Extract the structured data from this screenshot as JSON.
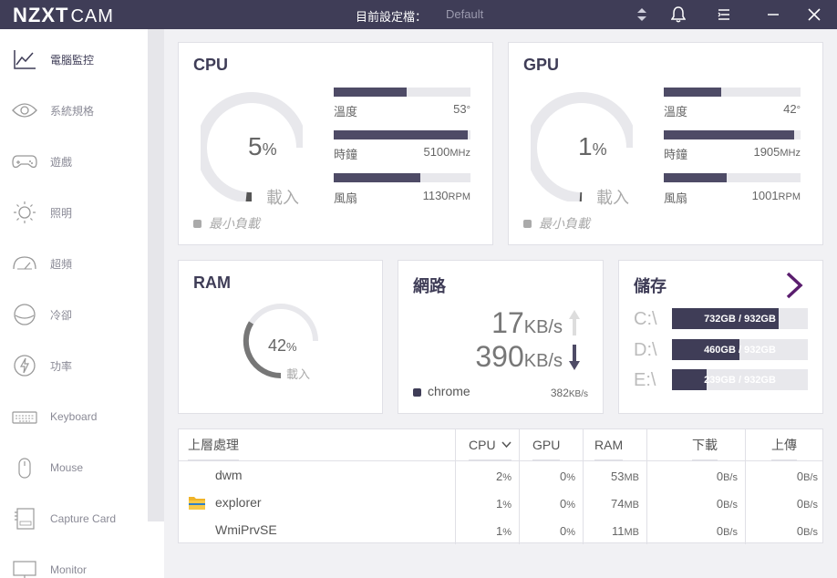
{
  "app": {
    "brand": "NZXT",
    "brand_suffix": "CAM",
    "profile_label": "目前設定檔：",
    "profile_value": "Default"
  },
  "sidebar": {
    "items": [
      {
        "label": "電腦監控",
        "icon": "chart-line-icon"
      },
      {
        "label": "系統規格",
        "icon": "eye-icon"
      },
      {
        "label": "遊戲",
        "icon": "gamepad-icon"
      },
      {
        "label": "照明",
        "icon": "sun-icon"
      },
      {
        "label": "超頻",
        "icon": "speedometer-icon"
      },
      {
        "label": "冷卻",
        "icon": "fan-icon"
      },
      {
        "label": "功率",
        "icon": "lightning-icon"
      },
      {
        "label": "Keyboard",
        "icon": "keyboard-icon"
      },
      {
        "label": "Mouse",
        "icon": "mouse-icon"
      },
      {
        "label": "Capture Card",
        "icon": "capture-card-icon"
      },
      {
        "label": "Monitor",
        "icon": "monitor-icon"
      }
    ]
  },
  "cpu": {
    "title": "CPU",
    "load_value": "5",
    "load_unit": "%",
    "load_fraction": 0.05,
    "load_label": "載入",
    "min_load": "最小負載",
    "stats": [
      {
        "label": "溫度",
        "value": "53",
        "unit": "°",
        "fill": 0.53
      },
      {
        "label": "時鐘",
        "value": "5100",
        "unit": "MHz",
        "fill": 0.98
      },
      {
        "label": "風扇",
        "value": "1130",
        "unit": "RPM",
        "fill": 0.63
      }
    ]
  },
  "gpu": {
    "title": "GPU",
    "load_value": "1",
    "load_unit": "%",
    "load_fraction": 0.01,
    "load_label": "載入",
    "min_load": "最小負載",
    "stats": [
      {
        "label": "溫度",
        "value": "42",
        "unit": "°",
        "fill": 0.42
      },
      {
        "label": "時鐘",
        "value": "1905",
        "unit": "MHz",
        "fill": 0.95
      },
      {
        "label": "風扇",
        "value": "1001",
        "unit": "RPM",
        "fill": 0.46
      }
    ]
  },
  "ram": {
    "title": "RAM",
    "load_value": "42",
    "load_unit": "%",
    "load_fraction": 0.42,
    "load_label": "載入"
  },
  "network": {
    "title": "網路",
    "upload_value": "17",
    "upload_unit": "KB/s",
    "download_value": "390",
    "download_unit": "KB/s",
    "top_process": "chrome",
    "top_process_value": "382",
    "top_process_unit": "KB/s"
  },
  "storage": {
    "title": "儲存",
    "drives": [
      {
        "label": "C:\\",
        "text": "732GB / 932GB",
        "fill": 0.785
      },
      {
        "label": "D:\\",
        "text": "460GB / 932GB",
        "fill": 0.494
      },
      {
        "label": "E:\\",
        "text": "239GB / 932GB",
        "fill": 0.256
      }
    ]
  },
  "processes": {
    "headers": {
      "name": "上層處理",
      "cpu": "CPU",
      "gpu": "GPU",
      "ram": "RAM",
      "download": "下載",
      "upload": "上傳"
    },
    "rows": [
      {
        "name": "dwm",
        "cpu": "2",
        "cpu_u": "%",
        "gpu": "0",
        "gpu_u": "%",
        "ram": "53",
        "ram_u": "MB",
        "down": "0",
        "down_u": "B/s",
        "up": "0",
        "up_u": "B/s"
      },
      {
        "name": "explorer",
        "cpu": "1",
        "cpu_u": "%",
        "gpu": "0",
        "gpu_u": "%",
        "ram": "74",
        "ram_u": "MB",
        "down": "0",
        "down_u": "B/s",
        "up": "0",
        "up_u": "B/s"
      },
      {
        "name": "WmiPrvSE",
        "cpu": "1",
        "cpu_u": "%",
        "gpu": "0",
        "gpu_u": "%",
        "ram": "11",
        "ram_u": "MB",
        "down": "0",
        "down_u": "B/s",
        "up": "0",
        "up_u": "B/s"
      }
    ]
  },
  "colors": {
    "titlebar": "#3f3d57",
    "accent": "#4e4b66",
    "storage_chevron": "#5a1d6e"
  }
}
